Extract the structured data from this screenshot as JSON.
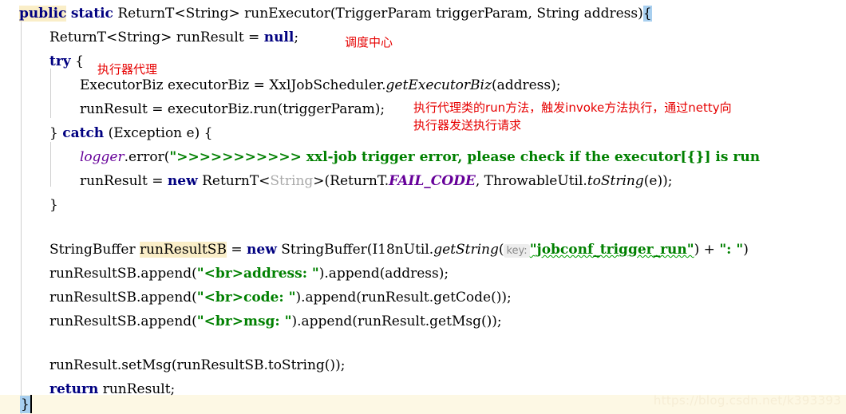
{
  "editor": {
    "language": "java",
    "watermark": "https://blog.csdn.net/k393393",
    "colors": {
      "background": "#ffffff",
      "keyword": "#000080",
      "string": "#008000",
      "generic": "#a9a9a9",
      "static_field": "#660099",
      "annotation_red": "#e60000",
      "identifier_highlight": "#faeec8",
      "bracket_match": "#a8cfef",
      "current_line": "#fdf8e4",
      "indent_guide": "#cfcfcf",
      "param_hint_bg": "#ededed",
      "param_hint_fg": "#8a8a8a"
    }
  },
  "code": {
    "l1": {
      "kw_public": "public",
      "kw_static": "static",
      "sig": " ReturnT<String> runExecutor(TriggerParam triggerParam, String address)",
      "brace": "{"
    },
    "l2": {
      "decl": "ReturnT<String> runResult = ",
      "kw_null": "null",
      "semi": ";"
    },
    "l3": {
      "kw_try": "try",
      "brace": " {"
    },
    "l4": {
      "pre": "ExecutorBiz executorBiz = XxlJobScheduler.",
      "mth": "getExecutorBiz",
      "post": "(address);"
    },
    "l5": {
      "text": "runResult = executorBiz.run(triggerParam);"
    },
    "l6": {
      "close": "} ",
      "kw_catch": "catch",
      "rest": " (Exception e) {"
    },
    "l7": {
      "logger": "logger",
      "call": ".error(",
      "str": "\">>>>>>>>>>> xxl-job trigger error, please check if the executor[{}] is run"
    },
    "l8": {
      "pre": "runResult = ",
      "kw_new": "new",
      "mid": " ReturnT<",
      "gen": "String",
      "mid2": ">(ReturnT.",
      "fld": "FAIL_CODE",
      "mid3": ", ThrowableUtil.",
      "mth": "toString",
      "post": "(e));"
    },
    "l9": {
      "text": "}"
    },
    "l11": {
      "type": "StringBuffer ",
      "ident": "runResultSB",
      "eq": " = ",
      "kw_new": "new",
      "mid": " StringBuffer(I18nUtil.",
      "mth": "getString",
      "paren": "(",
      "hint": "key:",
      "str": "\"jobconf_trigger_run\"",
      "post": ") + ",
      "str2": "\": \"",
      "post2": ")"
    },
    "l12": {
      "pre": "runResultSB.append(",
      "str": "\"<br>address: \"",
      "post": ").append(address);"
    },
    "l13": {
      "pre": "runResultSB.append(",
      "str": "\"<br>code: \"",
      "post": ").append(runResult.getCode());"
    },
    "l14": {
      "pre": "runResultSB.append(",
      "str": "\"<br>msg: \"",
      "post": ").append(runResult.getMsg());"
    },
    "l16": {
      "text": "runResult.setMsg(runResultSB.toString());"
    },
    "l17": {
      "kw_return": "return",
      "rest": " runResult;"
    },
    "l18": {
      "brace": "}"
    }
  },
  "annotations": {
    "scheduler": "调度中心",
    "executor_proxy": "执行器代理",
    "run_invoke": "执行代理类的run方法，触发invoke方法执行，通过netty向\n执行器发送执行请求"
  }
}
